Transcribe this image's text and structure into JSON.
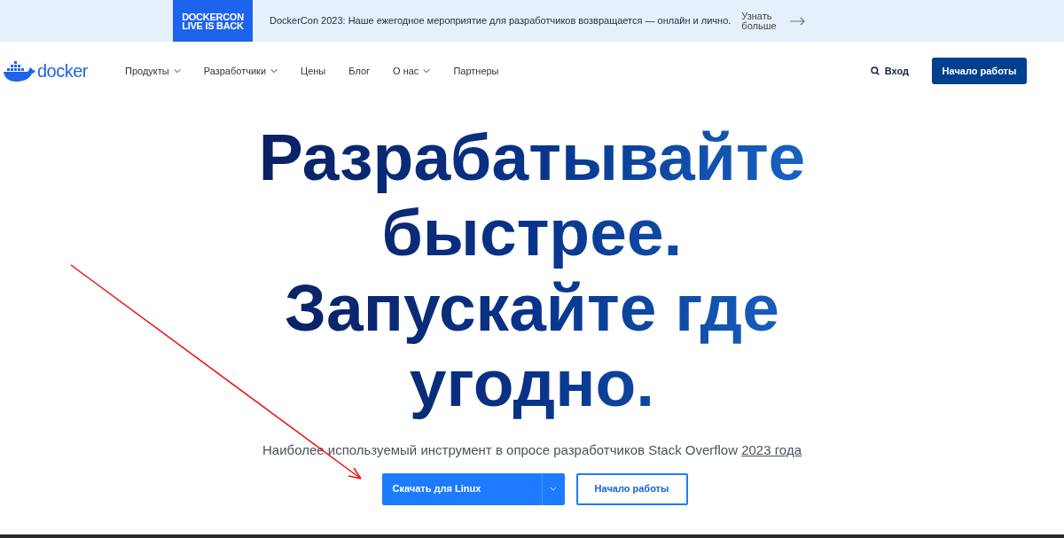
{
  "banner": {
    "logo_lines": [
      "DOCKERCON",
      "LIVE IS BACK"
    ],
    "text": "DockerCon 2023: Наше ежегодное мероприятие для разработчиков возвращается — онлайн и лично.",
    "link": "Узнать больше"
  },
  "nav": {
    "logo": "docker",
    "items": [
      {
        "label": "Продукты",
        "dropdown": true
      },
      {
        "label": "Разработчики",
        "dropdown": true
      },
      {
        "label": "Цены",
        "dropdown": false
      },
      {
        "label": "Блог",
        "dropdown": false
      },
      {
        "label": "О нас",
        "dropdown": true
      },
      {
        "label": "Партнеры",
        "dropdown": false
      }
    ],
    "login": "Вход",
    "cta": "Начало работы"
  },
  "hero": {
    "headline": "Разрабатывайте быстрее. Запускайте где угодно.",
    "subtitle": "Наиболее используемый инструмент в опросе разработчиков Stack Overflow",
    "subtitle_link": "2023 года",
    "primary_button": "Скачать для Linux",
    "secondary_button": "Начало работы"
  }
}
